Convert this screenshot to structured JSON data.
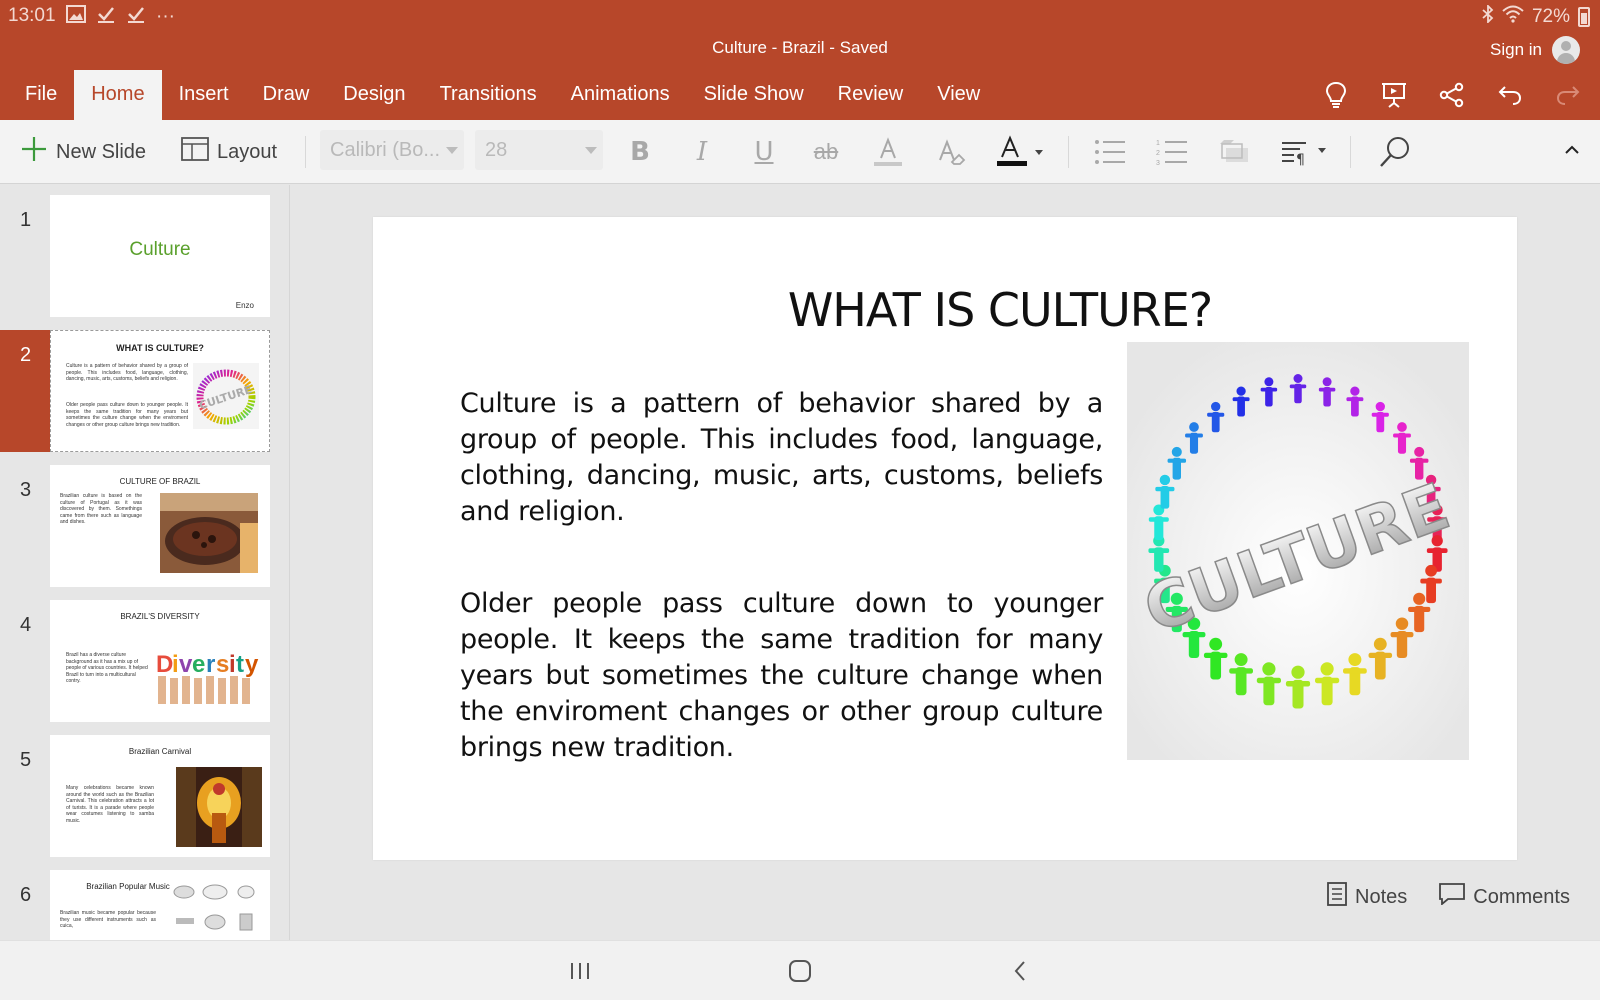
{
  "status": {
    "time": "13:01",
    "battery": "72%"
  },
  "document": {
    "title": "Culture - Brazil - Saved",
    "signin_label": "Sign in"
  },
  "tabs": [
    "File",
    "Home",
    "Insert",
    "Draw",
    "Design",
    "Transitions",
    "Animations",
    "Slide Show",
    "Review",
    "View"
  ],
  "active_tab": "Home",
  "ribbon": {
    "new_slide_label": "New Slide",
    "layout_label": "Layout",
    "font_name": "Calibri (Bo...",
    "font_size": "28"
  },
  "thumbnails": [
    {
      "num": "1",
      "title": "Culture",
      "footer": "Enzo"
    },
    {
      "num": "2",
      "title": "WHAT IS CULTURE?",
      "p1": "Culture is a pattern of behavior shared by a group of people. This includes food, language, clothing, dancing, music, arts, customs, beliefs and religion.",
      "p2": "Older people pass culture down to younger people. It keeps the same tradition for many years but sometimes the culture change when the enviroment changes or other group culture brings new tradition."
    },
    {
      "num": "3",
      "title": "CULTURE OF BRAZIL",
      "body": "Brazilian culture is based on the culture of Portugal as it was discovered by them. Somethings came from there such as language and dishes."
    },
    {
      "num": "4",
      "title": "BRAZIL'S DIVERSITY",
      "body": "Brazil has a diverse culture background as it has a mix up of people of various countries. It helped Brazil to turn into a multicultural contry.",
      "image_word": "Diversity"
    },
    {
      "num": "5",
      "title": "Brazilian Carnival",
      "body": "Many celebrations became known around the world such as the Brazilian Carnival. This celebration attracts a lot of turists. It is a parade where people wear costumes listening to samba music."
    },
    {
      "num": "6",
      "title": "Brazilian Popular Music",
      "body": "Brazilian music became popular because they use different instruments such as cuica,"
    }
  ],
  "slide": {
    "title": "WHAT IS CULTURE?",
    "paragraph1": "Culture is a pattern of behavior shared by a group of people. This includes food, language, clothing, dancing, music, arts, customs, beliefs and religion.",
    "paragraph2": "Older people pass culture down to younger people. It keeps the same tradition for many years but sometimes the culture change when the enviroment changes or other group culture brings new tradition.",
    "image_word": "CULTURE"
  },
  "footer": {
    "notes_label": "Notes",
    "comments_label": "Comments"
  },
  "colors": {
    "brand": "#b7472a",
    "ribbon_bg": "#f3f3f3",
    "canvas_bg": "#e6e6e6",
    "thumb1_title": "#5aa02c"
  },
  "icons": [
    "gallery-icon",
    "check-icon",
    "more-icon",
    "bluetooth-icon",
    "wifi-icon",
    "battery-icon",
    "avatar-icon",
    "lightbulb-icon",
    "present-icon",
    "share-icon",
    "undo-icon",
    "redo-icon",
    "plus-icon",
    "layout-icon",
    "bold-icon",
    "italic-icon",
    "underline-icon",
    "strikethrough-icon",
    "highlight-icon",
    "clear-format-icon",
    "font-color-icon",
    "bullets-icon",
    "numbering-icon",
    "shape-fill-icon",
    "paragraph-icon",
    "find-icon",
    "collapse-icon",
    "notes-icon",
    "comments-icon",
    "recents-icon",
    "home-icon",
    "back-icon"
  ]
}
